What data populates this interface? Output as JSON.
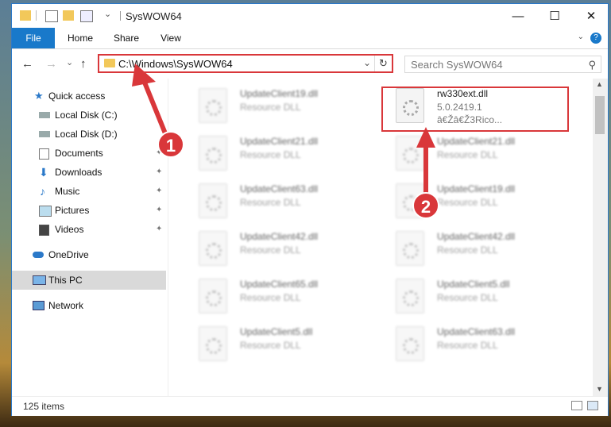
{
  "window": {
    "title": "SysWOW64",
    "controls": {
      "minimize": "—",
      "maximize": "☐",
      "close": "✕"
    }
  },
  "ribbon": {
    "tabs": [
      "File",
      "Home",
      "Share",
      "View"
    ],
    "help": "?",
    "caret": "⌄"
  },
  "nav": {
    "back": "←",
    "forward": "→",
    "recent": "⌄",
    "up": "↑",
    "address": "C:\\Windows\\SysWOW64",
    "address_caret": "⌄",
    "refresh": "↻",
    "search_placeholder": "Search SysWOW64",
    "search_icon": "⚲"
  },
  "sidebar": {
    "items": [
      {
        "label": "Quick access",
        "icon": "star-icon",
        "pinned": false
      },
      {
        "label": "Local Disk (C:)",
        "icon": "drive-icon",
        "pinned": true
      },
      {
        "label": "Local Disk (D:)",
        "icon": "drive-icon",
        "pinned": true
      },
      {
        "label": "Documents",
        "icon": "documents-icon",
        "pinned": true
      },
      {
        "label": "Downloads",
        "icon": "download-icon",
        "pinned": true
      },
      {
        "label": "Music",
        "icon": "music-icon",
        "pinned": true
      },
      {
        "label": "Pictures",
        "icon": "pictures-icon",
        "pinned": true
      },
      {
        "label": "Videos",
        "icon": "videos-icon",
        "pinned": true
      },
      {
        "label": "OneDrive",
        "icon": "cloud-icon",
        "pinned": false
      },
      {
        "label": "This PC",
        "icon": "computer-icon",
        "pinned": false,
        "selected": true
      },
      {
        "label": "Network",
        "icon": "network-icon",
        "pinned": false
      }
    ],
    "pin_glyph": "📌"
  },
  "files": {
    "left_column": [
      {
        "name": "UpdateClient19.dll",
        "type": "Resource DLL"
      },
      {
        "name": "UpdateClient21.dll",
        "type": "Resource DLL"
      },
      {
        "name": "UpdateClient63.dll",
        "type": "Resource DLL"
      },
      {
        "name": "UpdateClient42.dll",
        "type": "Resource DLL"
      },
      {
        "name": "UpdateClient65.dll",
        "type": "Resource DLL"
      },
      {
        "name": "UpdateClient5.dll",
        "type": "Resource DLL"
      }
    ],
    "right_column": [
      {
        "name": "rw330ext.dll",
        "type": "5.0.2419.1",
        "extra": "â€Žâ€Ž3Rico..."
      },
      {
        "name": "UpdateClient21.dll",
        "type": "Resource DLL"
      },
      {
        "name": "UpdateClient19.dll",
        "type": "Resource DLL"
      },
      {
        "name": "UpdateClient42.dll",
        "type": "Resource DLL"
      },
      {
        "name": "UpdateClient5.dll",
        "type": "Resource DLL"
      },
      {
        "name": "UpdateClient63.dll",
        "type": "Resource DLL"
      }
    ]
  },
  "status": {
    "items_count": "125 items"
  },
  "annotations": {
    "step1": "1",
    "step2": "2",
    "color": "#d9373a"
  },
  "colors": {
    "accent": "#1979ca",
    "highlight": "#d9373a",
    "folder": "#f2c85a"
  }
}
